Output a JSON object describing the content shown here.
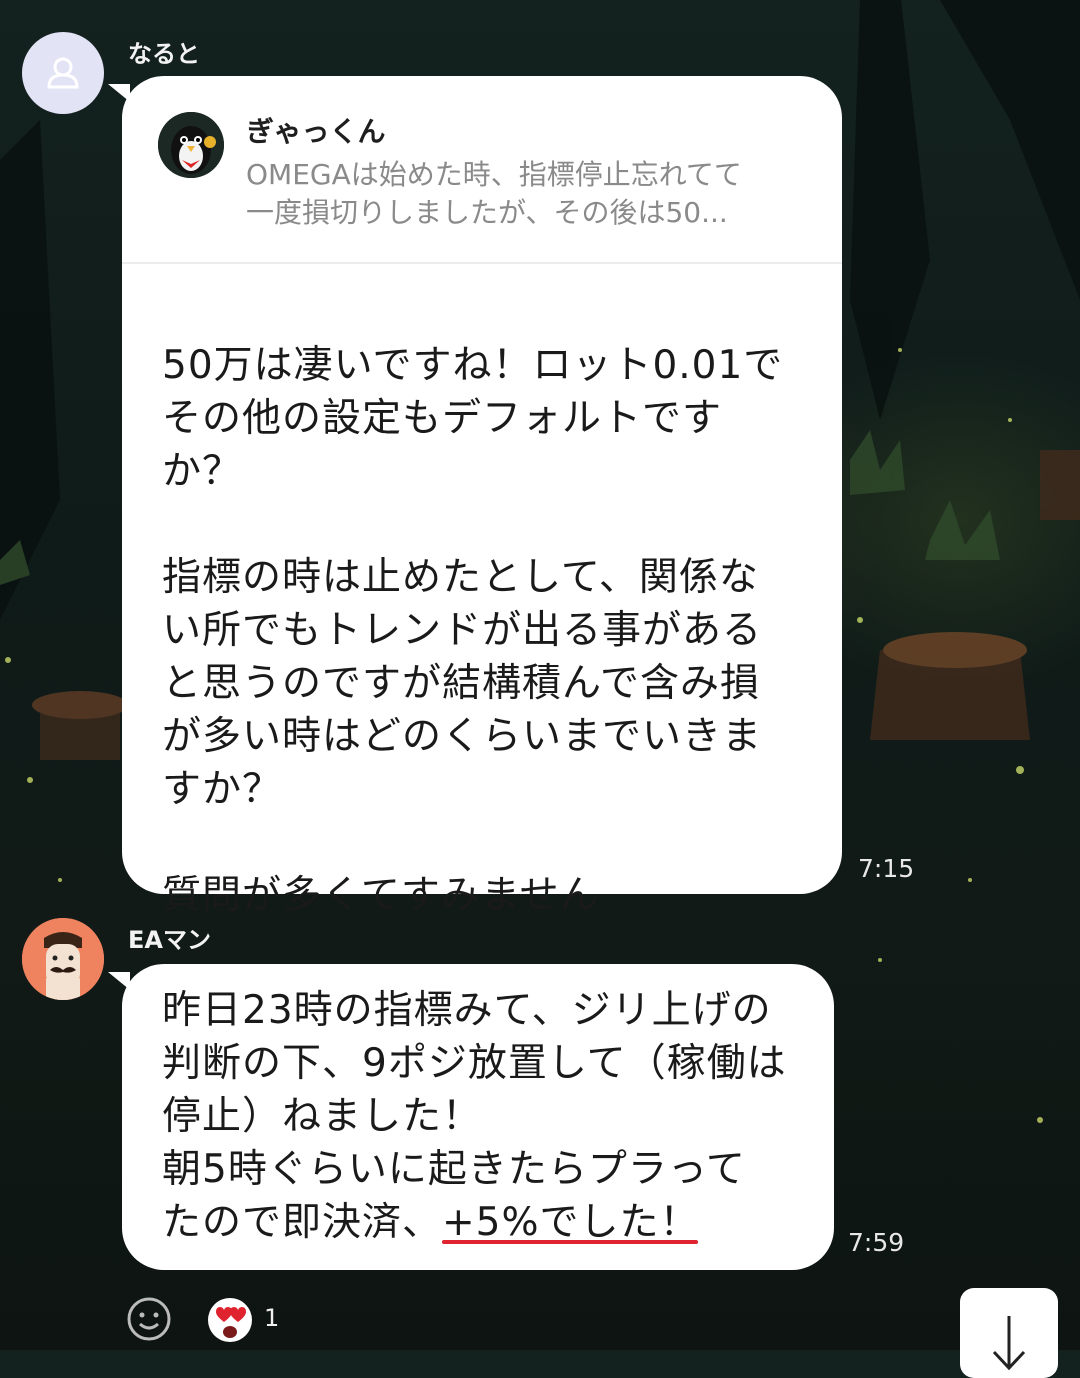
{
  "messages": [
    {
      "sender": "なると",
      "reply": {
        "name": "ぎゃっくん",
        "text": "OMEGAは始めた時、指標停止忘れてて\n一度損切りしましたが、その後は50..."
      },
      "text": "50万は凄いですね！ロット0.01で\nその他の設定もデフォルトです\nか？\n\n指標の時は止めたとして、関係な\nい所でもトレンドが出る事がある\nと思うのですが結構積んで含み損\nが多い時はどのくらいまでいきま\nすか？\n\n質問が多くてすみません",
      "time": "7:15"
    },
    {
      "sender": "EAマン",
      "text": "昨日23時の指標みて、ジリ上げの\n判断の下、9ポジ放置して（稼働は\n停止）ねました！\n朝5時ぐらいに起きたらプラって\nたので即決済、+5%でした！",
      "time": "7:59"
    }
  ],
  "reactions": {
    "count": "1"
  },
  "icons": {
    "default_avatar": "user-silhouette-icon",
    "reply_avatar": "penguin-avatar-icon",
    "eaman_avatar": "mustache-man-avatar-icon",
    "apology_emoji": "bowing-person-emoji-icon",
    "emoji_picker": "smiley-icon",
    "reaction": "heart-eyes-emoji-icon",
    "scroll_down": "arrow-down-icon"
  },
  "colors": {
    "bubble": "#ffffff",
    "highlight_underline": "#e0242f",
    "default_avatar_bg": "#e3e3f6",
    "eaman_avatar_bg": "#f0835f"
  }
}
